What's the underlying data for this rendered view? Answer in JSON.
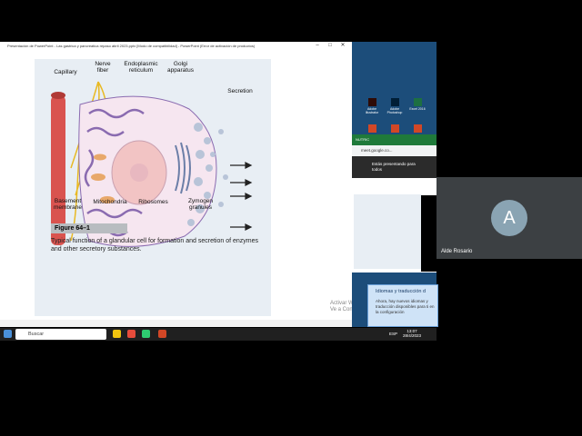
{
  "ppt": {
    "title": "Presentación de PowerPoint - Las gastrica y pancreatica repaso abril 2023.pptx [Modo de compatibilidad] - PowerPoint (Error de activación de productos)",
    "min_label": "–",
    "max_label": "□",
    "close_label": "✕",
    "watermark_line1": "Activar Windows",
    "watermark_line2": "Ve a Configuración"
  },
  "figure": {
    "labels": {
      "capillary": "Capillary",
      "nerve_fiber": "Nerve\nfiber",
      "endoplasmic_reticulum": "Endoplasmic\nreticulum",
      "golgi_apparatus": "Golgi\napparatus",
      "secretion": "Secretion",
      "basement_membrane": "Basement\nmembrane",
      "mitochondria": "Mitochondria",
      "ribosomes": "Ribosomes",
      "zymogen_granules": "Zymogen\ngranules"
    },
    "number": "Figure 64–1",
    "caption": "Typical function of a glandular cell for formation and secretion of enzymes and other secretory substances."
  },
  "desktop": {
    "icons": [
      {
        "label": "Adobe Illustrator",
        "color": "#2e0b06"
      },
      {
        "label": "Adobe Photoshop",
        "color": "#001e36"
      },
      {
        "label": "Excel 2016",
        "color": "#1d6f42"
      },
      {
        "label": "",
        "color": "#d24726"
      },
      {
        "label": "",
        "color": "#d24726"
      },
      {
        "label": "",
        "color": "#d24726"
      }
    ]
  },
  "chrome": {
    "tab": "NUTRIC",
    "url": "meet.google.co...",
    "presenting_line1": "Estás presentando para",
    "presenting_line2": "todos"
  },
  "toast": {
    "heading": "Idiomas y traducción d",
    "body": "Ahora, hay nuevos idiomas y traducción disponibles para ti en la configuración"
  },
  "taskbar": {
    "search_placeholder": "Buscar",
    "time": "13:07",
    "date": "28/4/2023",
    "lang": "ESP"
  },
  "meet": {
    "avatar_initial": "A",
    "participant_name": "Alde Rosario"
  },
  "colors": {
    "capillary": "#d9534f",
    "nerve": "#e8b923",
    "er": "#8a6bb0",
    "nucleus": "#f2c4c4",
    "granules": "#b8c4d8",
    "taskbar": "#202020"
  }
}
